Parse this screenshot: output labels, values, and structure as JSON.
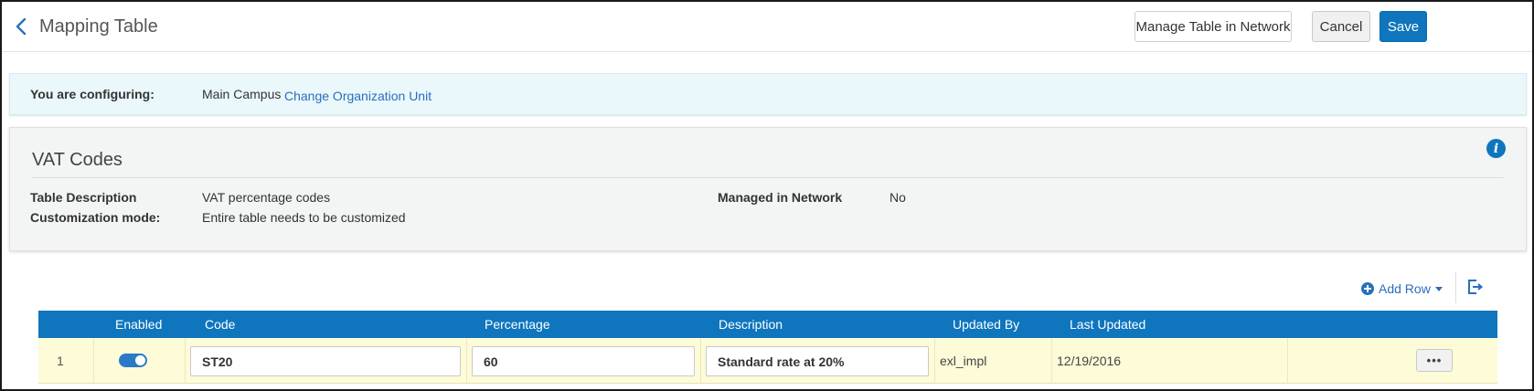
{
  "header": {
    "title": "Mapping Table",
    "back_icon": "chevron-left-icon",
    "buttons": {
      "manage": "Manage Table in Network",
      "cancel": "Cancel",
      "save": "Save"
    }
  },
  "config": {
    "label": "You are configuring:",
    "unit": "Main Campus",
    "change_link": "Change Organization Unit"
  },
  "table_info": {
    "title": "VAT Codes",
    "description_label": "Table Description",
    "description_value": "VAT percentage codes",
    "mode_label": "Customization mode:",
    "mode_value": "Entire table needs to be customized",
    "network_label": "Managed in Network",
    "network_value": "No",
    "info_icon": "info-icon"
  },
  "toolbar": {
    "add_row": "Add Row",
    "add_icon": "plus-circle-icon",
    "export_icon": "export-icon"
  },
  "grid": {
    "columns": [
      "Enabled",
      "Code",
      "Percentage",
      "Description",
      "Updated By",
      "Last Updated"
    ],
    "rows": [
      {
        "num": "1",
        "enabled": true,
        "code": "ST20",
        "percentage": "60",
        "description": "Standard rate at 20%",
        "updated_by": "exl_impl",
        "last_updated": "12/19/2016",
        "actions": "•••"
      }
    ]
  },
  "colors": {
    "primary": "#0f75bd",
    "link": "#2a6ebb",
    "config_bg": "#eaf8fc",
    "row_bg": "#fdfbd8"
  }
}
